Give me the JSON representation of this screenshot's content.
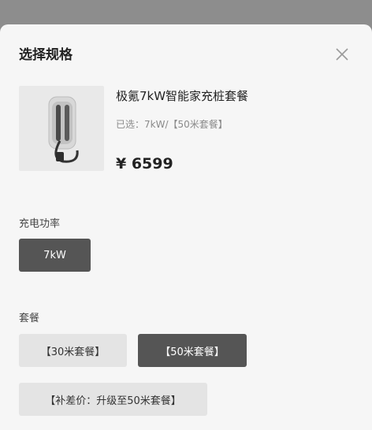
{
  "sheet": {
    "title": "选择规格",
    "close_icon": "close-icon"
  },
  "product": {
    "image_icon": "ev-charger-image",
    "name": "极氪7kW智能家充桩套餐",
    "selected": "已选：7kW/【50米套餐】",
    "price": "¥ 6599"
  },
  "power": {
    "label": "充电功率",
    "options": [
      {
        "label": "7kW",
        "selected": true
      }
    ]
  },
  "package": {
    "label": "套餐",
    "options": [
      {
        "label": "【30米套餐】",
        "selected": false
      },
      {
        "label": "【50米套餐】",
        "selected": true
      },
      {
        "label": "【补差价：升级至50米套餐】",
        "selected": false
      }
    ]
  },
  "colors": {
    "active_bg": "#555555",
    "inactive_bg": "#e4e4e4",
    "sheet_bg": "#f6f6f6",
    "overlay": "#8d8d8d"
  }
}
